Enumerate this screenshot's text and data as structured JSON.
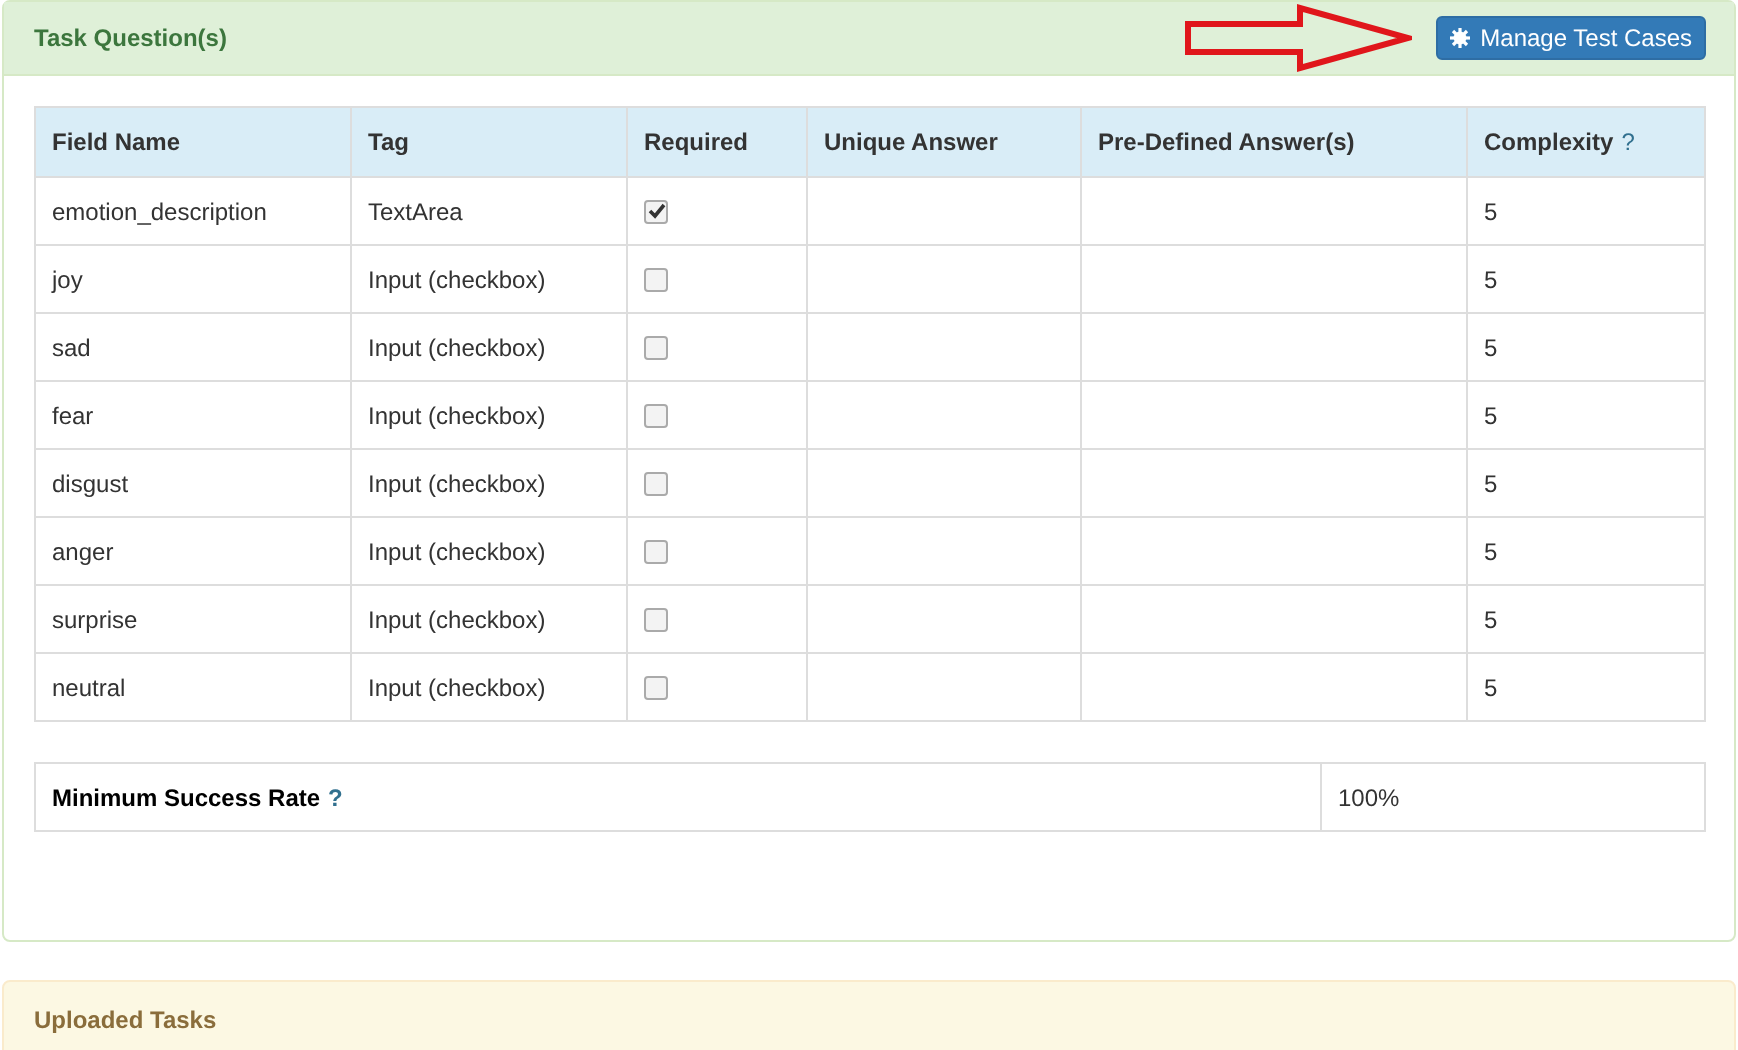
{
  "panel": {
    "title": "Task Question(s)",
    "button": "Manage Test Cases"
  },
  "table": {
    "columns": [
      "Field Name",
      "Tag",
      "Required",
      "Unique Answer",
      "Pre-Defined Answer(s)",
      "Complexity"
    ],
    "complexity_help": "?",
    "rows": [
      {
        "field": "emotion_description",
        "tag": "TextArea",
        "required": true,
        "complexity": "5"
      },
      {
        "field": "joy",
        "tag": "Input (checkbox)",
        "required": false,
        "complexity": "5"
      },
      {
        "field": "sad",
        "tag": "Input (checkbox)",
        "required": false,
        "complexity": "5"
      },
      {
        "field": "fear",
        "tag": "Input (checkbox)",
        "required": false,
        "complexity": "5"
      },
      {
        "field": "disgust",
        "tag": "Input (checkbox)",
        "required": false,
        "complexity": "5"
      },
      {
        "field": "anger",
        "tag": "Input (checkbox)",
        "required": false,
        "complexity": "5"
      },
      {
        "field": "surprise",
        "tag": "Input (checkbox)",
        "required": false,
        "complexity": "5"
      },
      {
        "field": "neutral",
        "tag": "Input (checkbox)",
        "required": false,
        "complexity": "5"
      }
    ]
  },
  "success_rate": {
    "label": "Minimum Success Rate",
    "help": "?",
    "value": "100%"
  },
  "uploaded": {
    "title": "Uploaded Tasks"
  }
}
